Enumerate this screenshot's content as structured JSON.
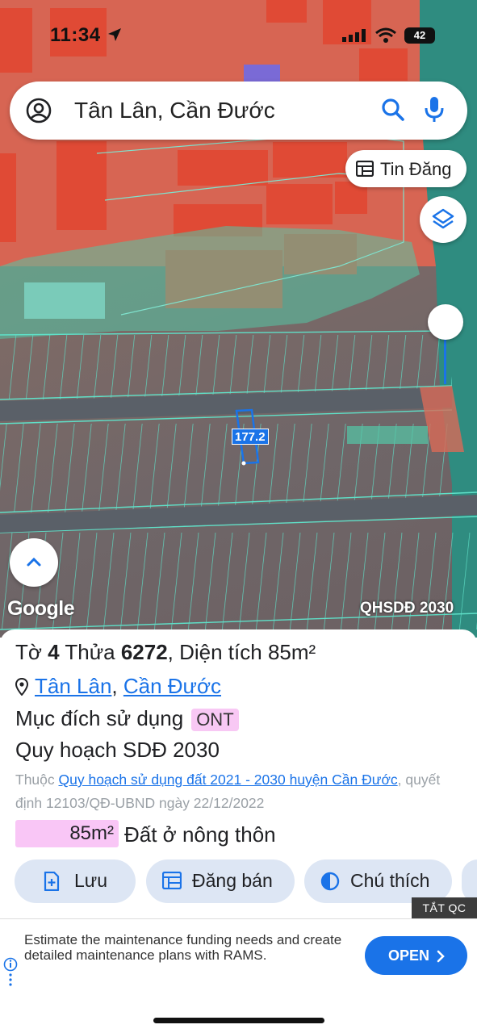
{
  "status_bar": {
    "time": "11:34",
    "battery": "42"
  },
  "search": {
    "query": "Tân Lân, Cần Đước"
  },
  "map": {
    "tin_dang_label": "Tin Đăng",
    "plot_label": "177.2",
    "google_label": "Google",
    "plan_tag": "QHSDĐ 2030"
  },
  "parcel": {
    "title_prefix": "Tờ ",
    "sheet_no": "4",
    "thua_label": " Thửa ",
    "parcel_no": "6272",
    "area_label": ", Diện tích ",
    "area_value": "85m²",
    "location_a": "Tân Lân",
    "location_sep": ", ",
    "location_b": "Cần Đước",
    "purpose_label": "Mục đích sử dụng",
    "purpose_code": "ONT",
    "plan_label": "Quy hoạch SDĐ 2030",
    "belongs_prefix": "Thuộc ",
    "belongs_link": "Quy hoạch sử dụng đất 2021 - 2030 huyện Cần Đước",
    "belongs_suffix": ", quyết định 12103/QĐ-UBND ngày 22/12/2022",
    "area_box": "85m²",
    "area_desc": "Đất ở nông thôn"
  },
  "actions": {
    "save": "Lưu",
    "post": "Đăng bán",
    "legend": "Chú thích"
  },
  "ad_close": "TẮT QC",
  "ad": {
    "copy": "Estimate the maintenance funding needs and create detailed maintenance plans with RAMS.",
    "cta": "OPEN"
  },
  "colors": {
    "accent": "#1a73e8",
    "badge": "#f8c8f4",
    "parcel_line": "#5fe0c8"
  }
}
